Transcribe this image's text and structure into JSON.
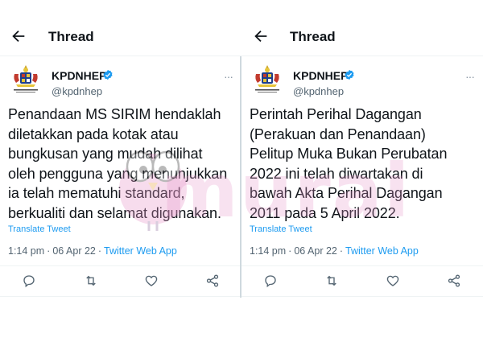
{
  "colors": {
    "accent": "#1d9bf0",
    "text": "#0f1419",
    "muted": "#536471",
    "watermark": "#e896c8"
  },
  "left_panel": {
    "header": {
      "back_icon": "arrow-left-icon",
      "title": "Thread"
    },
    "author": {
      "name": "KPDNHEP",
      "handle": "@kpdnhep",
      "verified_icon": "verified-badge-icon",
      "more_icon": "more-horizontal-icon"
    },
    "tweet_lines": [
      "Penandaan MS SIRIM hendaklah",
      "diletakkan pada kotak atau",
      "bungkusan yang mudah dilihat",
      "oleh pengguna yang menunjukkan",
      "ia telah mematuhi standard,",
      "berkualiti dan selamat digunakan."
    ],
    "translate_label": "Translate Tweet",
    "timestamp": "1:14 pm",
    "date": "06 Apr 22",
    "source": "Twitter Web App",
    "actions": [
      "reply-icon",
      "retweet-icon",
      "like-icon",
      "share-icon"
    ]
  },
  "right_panel": {
    "header": {
      "back_icon": "arrow-left-icon",
      "title": "Thread"
    },
    "author": {
      "name": "KPDNHEP",
      "handle": "@kpdnhep",
      "verified_icon": "verified-badge-icon",
      "more_icon": "more-horizontal-icon"
    },
    "tweet_lines": [
      "Perintah Perihal Dagangan",
      "(Perakuan dan Penandaan)",
      "Pelitup Muka Bukan Perubatan",
      "2022 ini telah diwartakan di",
      "bawah Akta Perihal Dagangan",
      "2011 pada 5 April 2022."
    ],
    "translate_label": "Translate Tweet",
    "timestamp": "1:14 pm",
    "date": "06 Apr 22",
    "source": "Twitter Web App",
    "actions": [
      "reply-icon",
      "retweet-icon",
      "like-icon",
      "share-icon"
    ]
  },
  "watermark": {
    "text": "murai"
  },
  "separator": "·"
}
